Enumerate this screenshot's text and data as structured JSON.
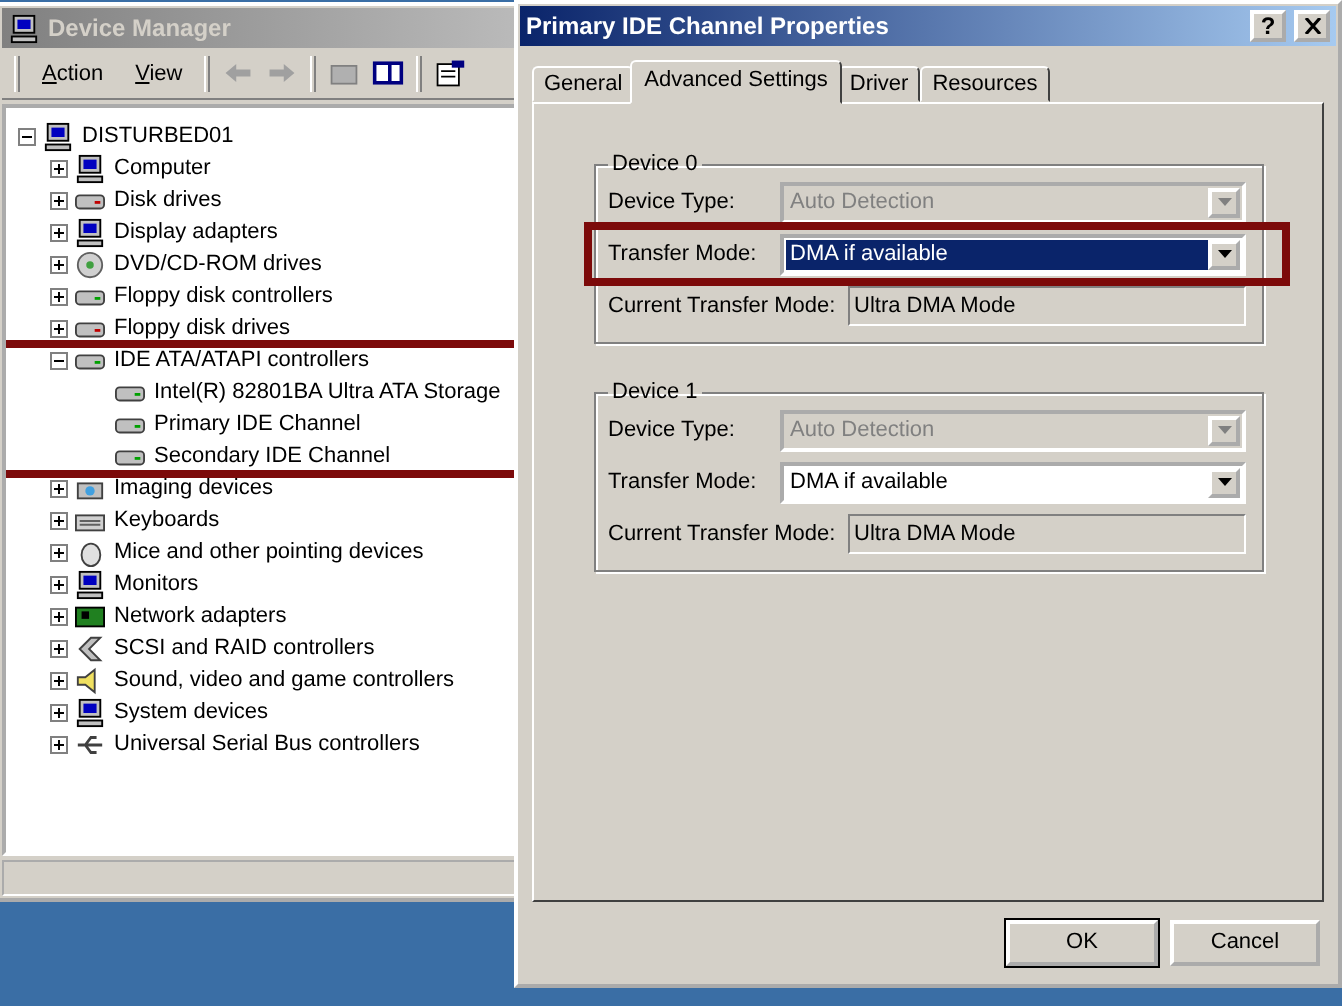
{
  "device_manager": {
    "title": "Device Manager",
    "menu": [
      {
        "mnemonic": "A",
        "rest": "ction"
      },
      {
        "mnemonic": "V",
        "rest": "iew"
      }
    ],
    "tree": {
      "label": "DISTURBED01",
      "expanded": true,
      "children": [
        {
          "label": "Computer",
          "expanded": false,
          "highlighted": false
        },
        {
          "label": "Disk drives",
          "expanded": false,
          "highlighted": false
        },
        {
          "label": "Display adapters",
          "expanded": false,
          "highlighted": false
        },
        {
          "label": "DVD/CD-ROM drives",
          "expanded": false,
          "highlighted": false
        },
        {
          "label": "Floppy disk controllers",
          "expanded": false,
          "highlighted": false
        },
        {
          "label": "Floppy disk drives",
          "expanded": false,
          "highlighted": false
        },
        {
          "label": "IDE ATA/ATAPI controllers",
          "expanded": true,
          "highlighted": true,
          "children": [
            {
              "label": "Intel(R) 82801BA Ultra ATA Storage"
            },
            {
              "label": "Primary IDE Channel"
            },
            {
              "label": "Secondary IDE Channel"
            }
          ]
        },
        {
          "label": "Imaging devices",
          "expanded": false,
          "highlighted": false
        },
        {
          "label": "Keyboards",
          "expanded": false,
          "highlighted": false
        },
        {
          "label": "Mice and other pointing devices",
          "expanded": false,
          "highlighted": false
        },
        {
          "label": "Monitors",
          "expanded": false,
          "highlighted": false
        },
        {
          "label": "Network adapters",
          "expanded": false,
          "highlighted": false
        },
        {
          "label": "SCSI and RAID controllers",
          "expanded": false,
          "highlighted": false
        },
        {
          "label": "Sound, video and game controllers",
          "expanded": false,
          "highlighted": false
        },
        {
          "label": "System devices",
          "expanded": false,
          "highlighted": false
        },
        {
          "label": "Universal Serial Bus controllers",
          "expanded": false,
          "highlighted": false
        }
      ]
    }
  },
  "dialog": {
    "title": "Primary IDE Channel Properties",
    "help": "?",
    "tabs": [
      {
        "label": "General",
        "selected": false
      },
      {
        "label": "Advanced Settings",
        "selected": true
      },
      {
        "label": "Driver",
        "selected": false
      },
      {
        "label": "Resources",
        "selected": false
      }
    ],
    "groups": [
      {
        "title": "Device 0",
        "fields": [
          {
            "kind": "dropdown",
            "label": "Device Type:",
            "value": "Auto Detection",
            "disabled": true,
            "focused": false,
            "highlighted": false
          },
          {
            "kind": "dropdown",
            "label": "Transfer Mode:",
            "value": "DMA if available",
            "disabled": false,
            "focused": true,
            "highlighted": true
          },
          {
            "kind": "readonly",
            "label": "Current Transfer Mode:",
            "value": "Ultra DMA Mode"
          }
        ]
      },
      {
        "title": "Device 1",
        "fields": [
          {
            "kind": "dropdown",
            "label": "Device Type:",
            "value": "Auto Detection",
            "disabled": true,
            "focused": false,
            "highlighted": false
          },
          {
            "kind": "dropdown",
            "label": "Transfer Mode:",
            "value": "DMA if available",
            "disabled": false,
            "focused": false,
            "highlighted": false
          },
          {
            "kind": "readonly",
            "label": "Current Transfer Mode:",
            "value": "Ultra DMA Mode"
          }
        ]
      }
    ],
    "buttons": [
      {
        "label": "OK",
        "default": true
      },
      {
        "label": "Cancel",
        "default": false
      }
    ]
  }
}
